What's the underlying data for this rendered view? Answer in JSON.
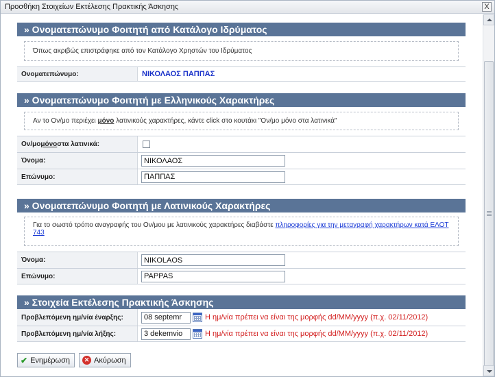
{
  "window": {
    "title": "Προσθήκη Στοιχείων Εκτέλεσης Πρακτικής Άσκησης",
    "close_label": "X"
  },
  "section1": {
    "header": "» Ονοματεπώνυμο Φοιτητή από Κατάλογο Ιδρύματος",
    "note": "Όπως ακριβώς επιστράφηκε από τον Κατάλογο Χρηστών του Ιδρύματος",
    "label": "Ονοματεπώνυμο:",
    "value": "ΝΙΚΟΛΑΟΣ ΠΑΠΠΑΣ"
  },
  "section2": {
    "header": "» Ονοματεπώνυμο Φοιτητή με Ελληνικούς Χαρακτήρες",
    "note_pre": "Αν το Ον/μο περιέχει ",
    "note_bold": "μόνο",
    "note_post": " λατινικούς χαρακτήρες, κάντε click στο κουτάκι \"Ον/μο μόνο στα λατινικά\"",
    "latin_label_pre": "Ον/μο ",
    "latin_label_bold": "μόνο",
    "latin_label_post": " στα λατινικά:",
    "first_label": "Όνομα:",
    "first_value": "ΝΙΚΟΛΑΟΣ",
    "last_label": "Επώνυμο:",
    "last_value": "ΠΑΠΠΑΣ"
  },
  "section3": {
    "header": "» Ονοματεπώνυμο Φοιτητή με Λατινικούς Χαρακτήρες",
    "note_pre": "Για το σωστό τρόπο αναγραφής του Ον/μου με λατινικούς χαρακτήρες διαβάστε ",
    "note_link": "πληροφορίες για την μεταγραφή χαρακτήρων κατά ΕΛΟΤ 743",
    "first_label": "Όνομα:",
    "first_value": "NIKOLAOS",
    "last_label": "Επώνυμο:",
    "last_value": "PAPPAS"
  },
  "section4": {
    "header": "» Στοιχεία Εκτέλεσης Πρακτικής Άσκησης",
    "start_label": "Προβλεπόμενη ημ/νία έναρξης:",
    "start_value": "08 septemr",
    "end_label": "Προβλεπόμενη ημ/νία λήξης:",
    "end_value": "3 dekemvio",
    "error_text": "Η ημ/νία πρέπει να είναι της μορφής dd/MM/yyyy (π.χ. 02/11/2012)"
  },
  "buttons": {
    "save": "Ενημέρωση",
    "cancel": "Ακύρωση"
  },
  "colors": {
    "section_header": "#5a7497",
    "error": "#d21d1d",
    "name_blue": "#1a32c9"
  }
}
